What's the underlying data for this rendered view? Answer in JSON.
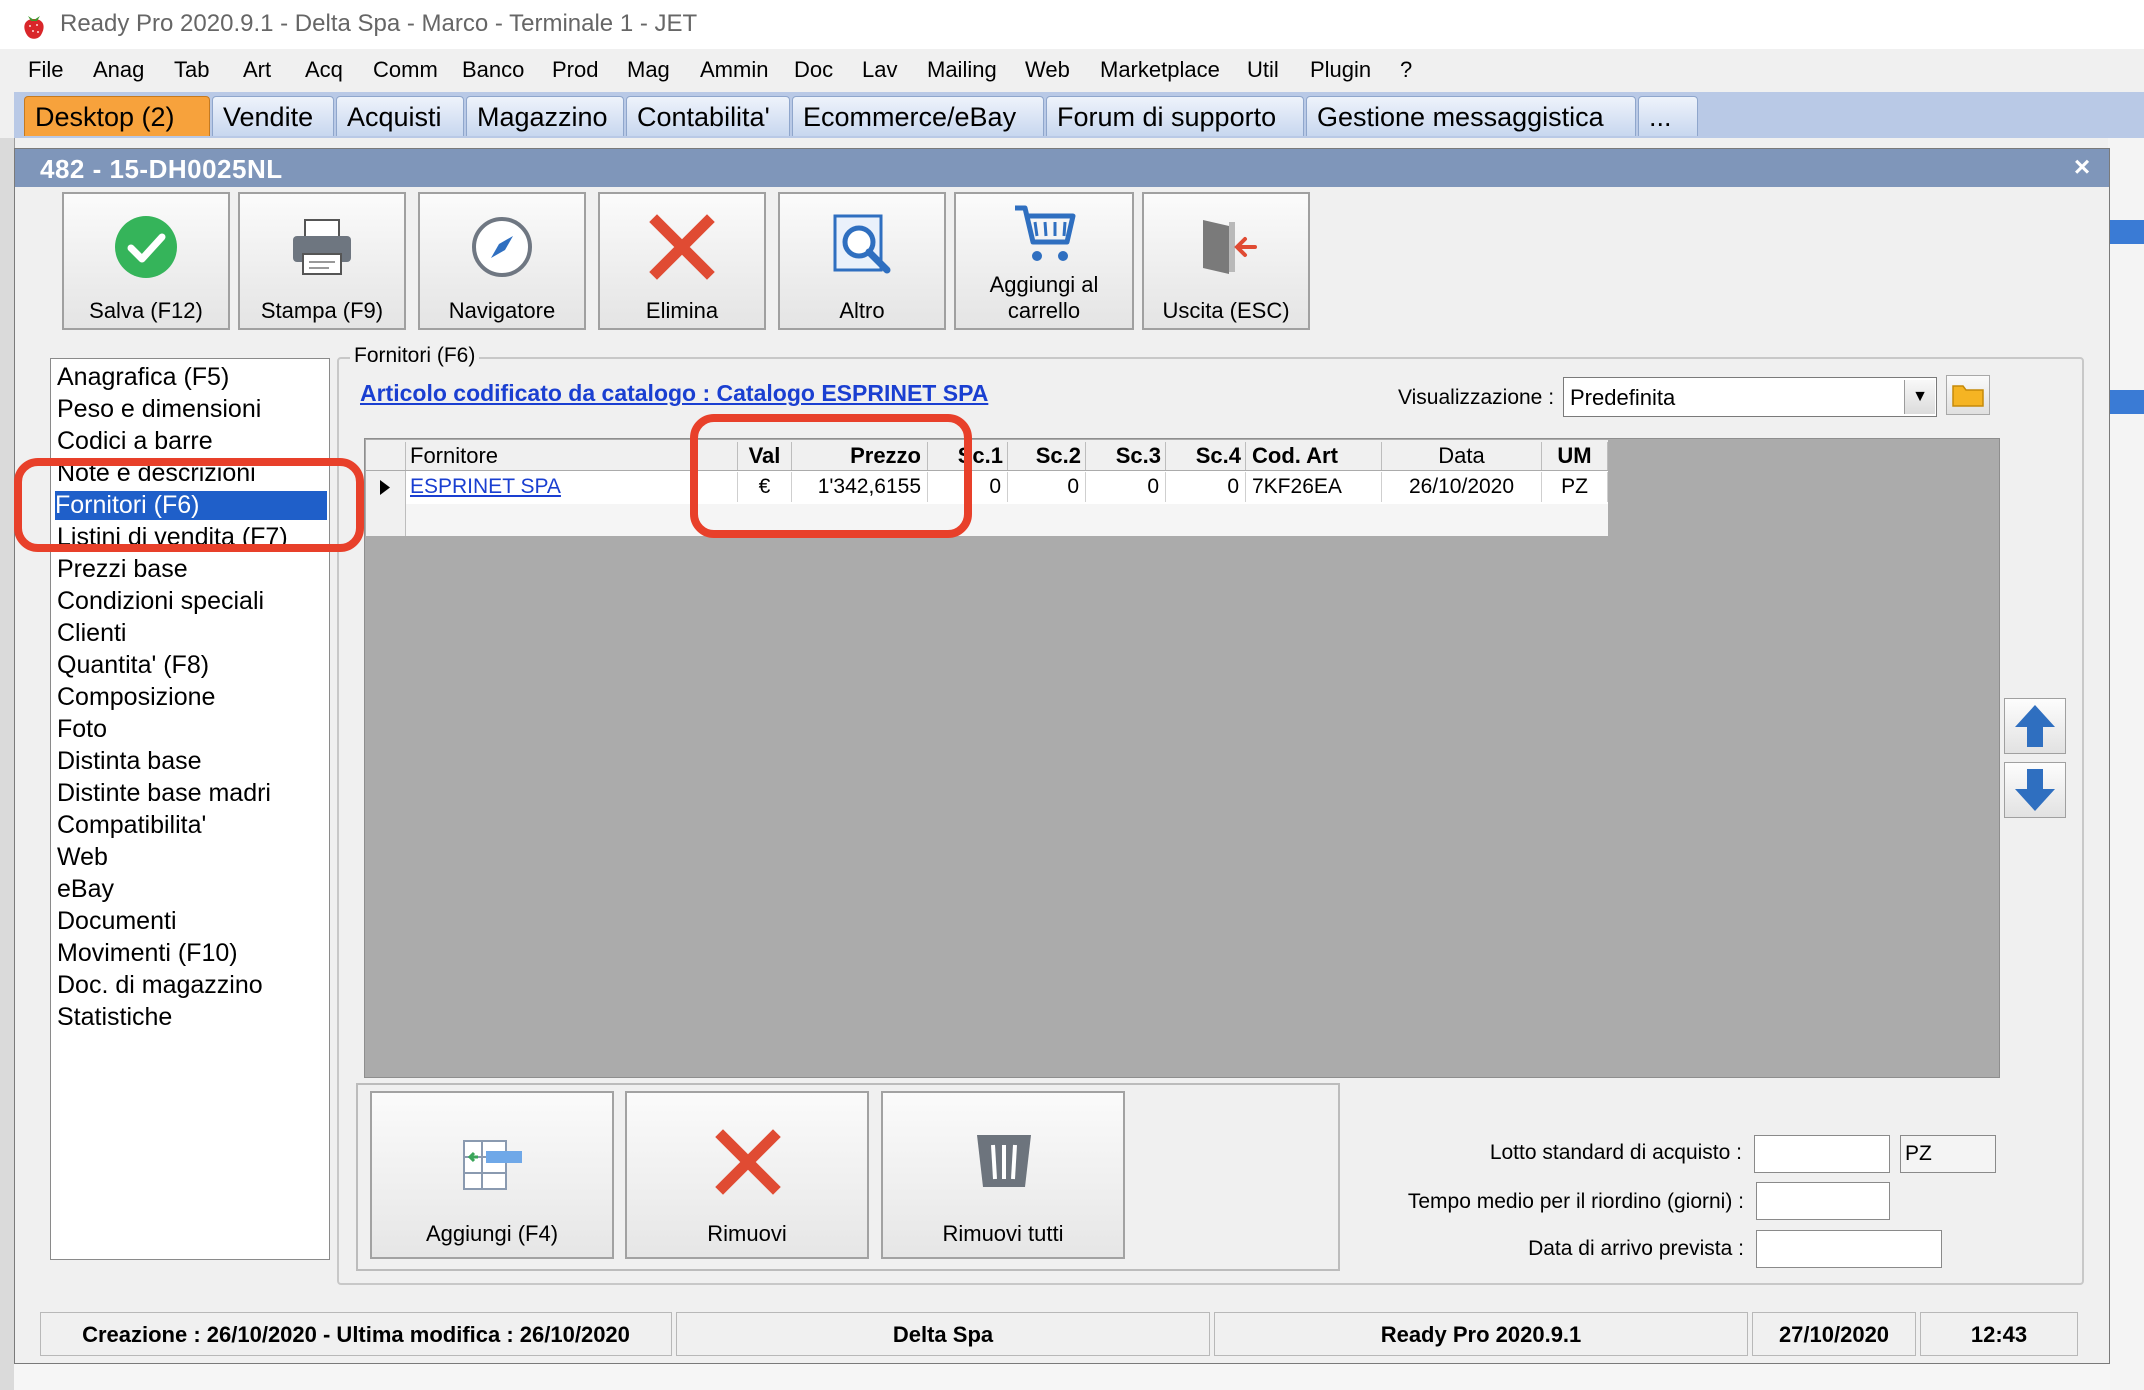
{
  "window": {
    "title": "Ready Pro 2020.9.1 - Delta Spa - Marco - Terminale 1 - JET"
  },
  "menu": [
    "File",
    "Anag",
    "Tab",
    "Art",
    "Acq",
    "Comm",
    "Banco",
    "Prod",
    "Mag",
    "Ammin",
    "Doc",
    "Lav",
    "Mailing",
    "Web",
    "Marketplace",
    "Util",
    "Plugin",
    "?"
  ],
  "tabs": [
    "Desktop (2)",
    "Vendite",
    "Acquisti",
    "Magazzino",
    "Contabilita'",
    "Ecommerce/eBay",
    "Forum di supporto",
    "Gestione messaggistica",
    "..."
  ],
  "dialog": {
    "title": "482 - 15-DH0025NL",
    "close": "×"
  },
  "toolbar": {
    "save": "Salva (F12)",
    "print": "Stampa (F9)",
    "navigator": "Navigatore",
    "delete": "Elimina",
    "other": "Altro",
    "cart_line1": "Aggiungi al",
    "cart_line2": "carrello",
    "exit": "Uscita (ESC)"
  },
  "nav": {
    "items": [
      "Anagrafica (F5)",
      "Peso e dimensioni",
      "Codici a barre",
      "Note e descrizioni",
      "Fornitori (F6)",
      "Listini di vendita (F7)",
      "Prezzi base",
      "Condizioni speciali",
      "Clienti",
      "Quantita' (F8)",
      "Composizione",
      "Foto",
      "Distinta base",
      "Distinte base madri",
      "Compatibilita'",
      "Web",
      "eBay",
      "Documenti",
      "Movimenti (F10)",
      "Doc. di magazzino",
      "Statistiche"
    ],
    "selected": 4
  },
  "section": {
    "title": "Fornitori (F6)",
    "catalog_link": "Articolo codificato da catalogo : Catalogo ESPRINET SPA",
    "view_label": "Visualizzazione :",
    "view_value": "Predefinita"
  },
  "grid": {
    "headers": [
      "Fornitore",
      "Val",
      "Prezzo",
      "Sc.1",
      "Sc.2",
      "Sc.3",
      "Sc.4",
      "Cod. Art",
      "Data",
      "UM"
    ],
    "rows": [
      [
        "ESPRINET SPA",
        "€",
        "1'342,6155",
        "0",
        "0",
        "0",
        "0",
        "7KF26EA",
        "26/10/2020",
        "PZ"
      ]
    ]
  },
  "bottom_buttons": {
    "add": "Aggiungi (F4)",
    "remove": "Rimuovi",
    "remove_all": "Rimuovi tutti"
  },
  "fields": {
    "lot_label": "Lotto standard di acquisto :",
    "lot_value": "",
    "lot_unit": "PZ",
    "reorder_label": "Tempo medio per il riordino (giorni) :",
    "reorder_value": "",
    "arrival_label": "Data di arrivo prevista :",
    "arrival_value": ""
  },
  "status": {
    "dates": "Creazione : 26/10/2020 - Ultima modifica : 26/10/2020",
    "company": "Delta Spa",
    "version": "Ready Pro 2020.9.1",
    "date": "27/10/2020",
    "time": "12:43"
  },
  "colors": {
    "highlight": "#e8402a",
    "selection": "#1f5fc9",
    "active_tab": "#f7a23c",
    "link": "#1a3fd1"
  }
}
